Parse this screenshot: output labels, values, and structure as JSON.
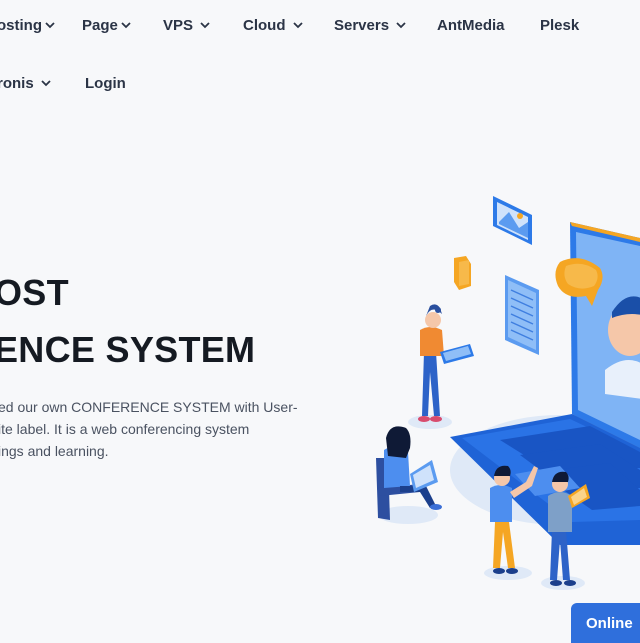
{
  "nav": {
    "row1": [
      {
        "label": "osting",
        "chevron": true
      },
      {
        "label": "Page",
        "chevron": true
      },
      {
        "label": "VPS",
        "chevron": true
      },
      {
        "label": "Cloud",
        "chevron": true
      },
      {
        "label": "Servers",
        "chevron": true
      },
      {
        "label": "AntMedia",
        "chevron": false
      },
      {
        "label": "Plesk",
        "chevron": false
      }
    ],
    "row2": [
      {
        "label": "ronis",
        "chevron": true
      },
      {
        "label": "Login",
        "chevron": false
      }
    ]
  },
  "hero": {
    "headline_line1": "OST",
    "headline_line2": "ENCE SYSTEM",
    "body_lines": [
      "ed our own CONFERENCE SYSTEM with User-",
      "ite label. It is a web conferencing system",
      "ings and learning."
    ]
  },
  "chat": {
    "online_label": "Online"
  },
  "colors": {
    "accent": "#2f6fdc",
    "laptop_blue": "#1f63d6",
    "illustration_orange": "#f5a623"
  },
  "icons": [
    "chevron-down-icon",
    "picture-icon",
    "document-icon",
    "chat-bubble-icon",
    "video-call-icon"
  ]
}
